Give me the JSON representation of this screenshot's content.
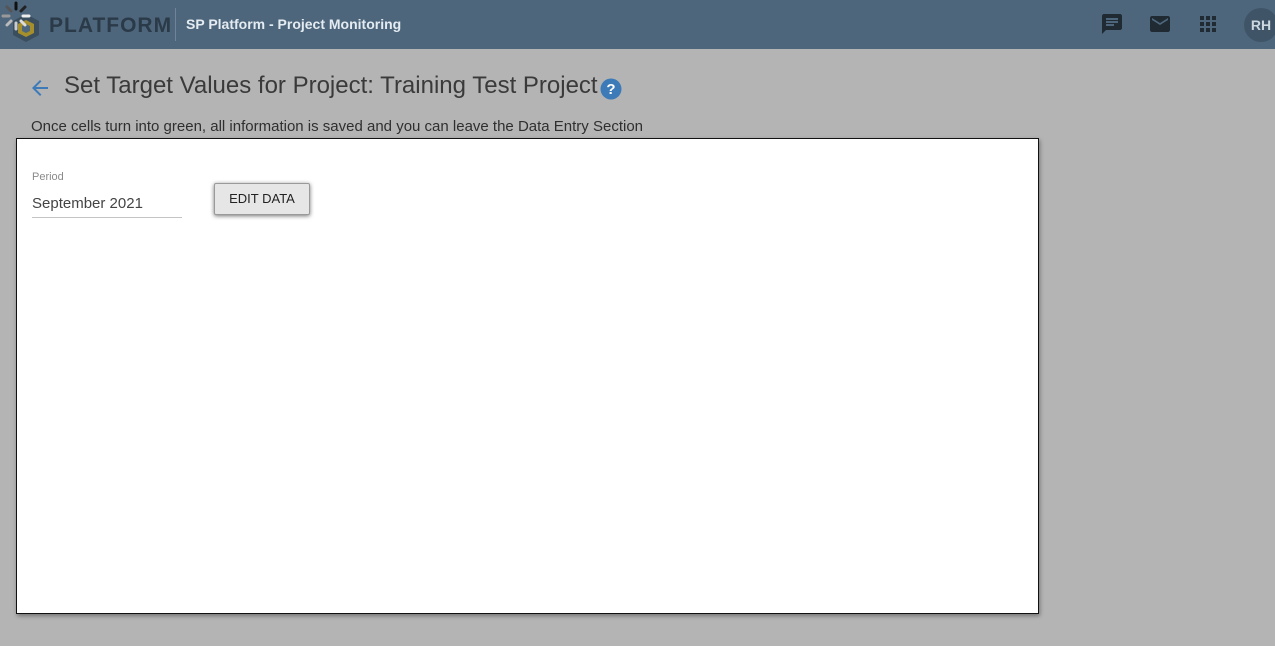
{
  "app": {
    "logo_text": "PLATFORM",
    "title": "SP Platform - Project Monitoring",
    "user_initials": "RH",
    "topbar_color": "#4d667c",
    "icons": [
      "loading-spinner-icon",
      "chat-icon",
      "mail-icon",
      "apps-grid-icon"
    ]
  },
  "header": {
    "title": "Set Target Values for Project: Training Test Project",
    "info": "Once cells turn into green, all information is saved and you can leave the Data Entry Section",
    "accent_color": "#3d7ab8"
  },
  "form": {
    "period_label": "Period",
    "period_value": "September 2021",
    "edit_button": "EDIT DATA"
  }
}
